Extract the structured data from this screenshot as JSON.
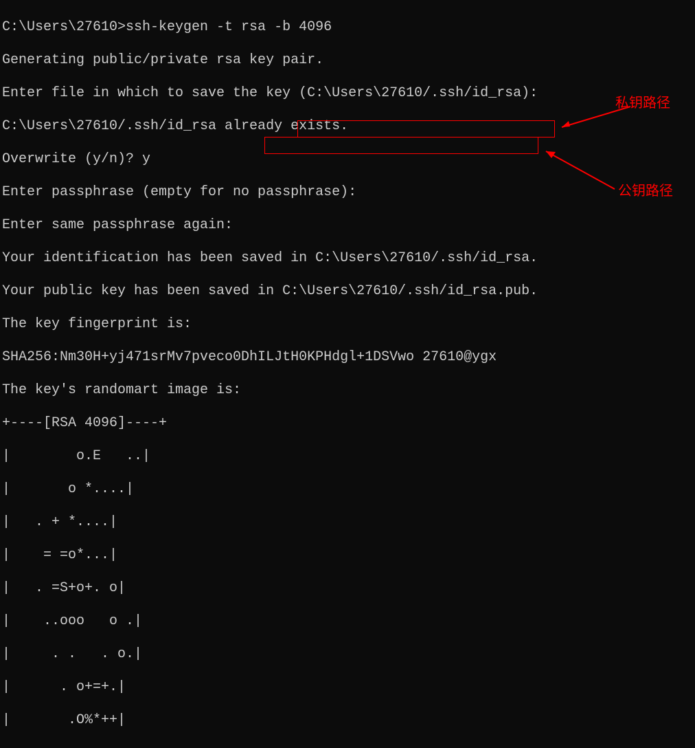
{
  "terminal": {
    "lines": [
      "C:\\Users\\27610>ssh-keygen -t rsa -b 4096",
      "Generating public/private rsa key pair.",
      "Enter file in which to save the key (C:\\Users\\27610/.ssh/id_rsa):",
      "C:\\Users\\27610/.ssh/id_rsa already exists.",
      "Overwrite (y/n)? y",
      "Enter passphrase (empty for no passphrase):",
      "Enter same passphrase again:",
      "Your identification has been saved in C:\\Users\\27610/.ssh/id_rsa.",
      "Your public key has been saved in C:\\Users\\27610/.ssh/id_rsa.pub.",
      "The key fingerprint is:",
      "SHA256:Nm30H+yj471srMv7pveco0DhILJtH0KPHdgl+1DSVwo 27610@ygx",
      "The key's randomart image is:",
      "+----[RSA 4096]----+",
      "|        o.E   ..|",
      "|       o *....|",
      "|   . + *....|",
      "|    = =o*...|",
      "|   . =S+o+. o|",
      "|    ..ooo   o .|",
      "|     . .   . o.|",
      "|      . o+=+.|",
      "|       .O%*++|"
    ]
  },
  "annotations": {
    "private_key": "私钥路径",
    "public_key": "公钥路径"
  },
  "highlights": {
    "private_key_path": "C:\\Users\\27610/.ssh/id_rsa.",
    "public_key_path": "C:\\Users\\27610/.ssh/id_rsa.pub."
  }
}
